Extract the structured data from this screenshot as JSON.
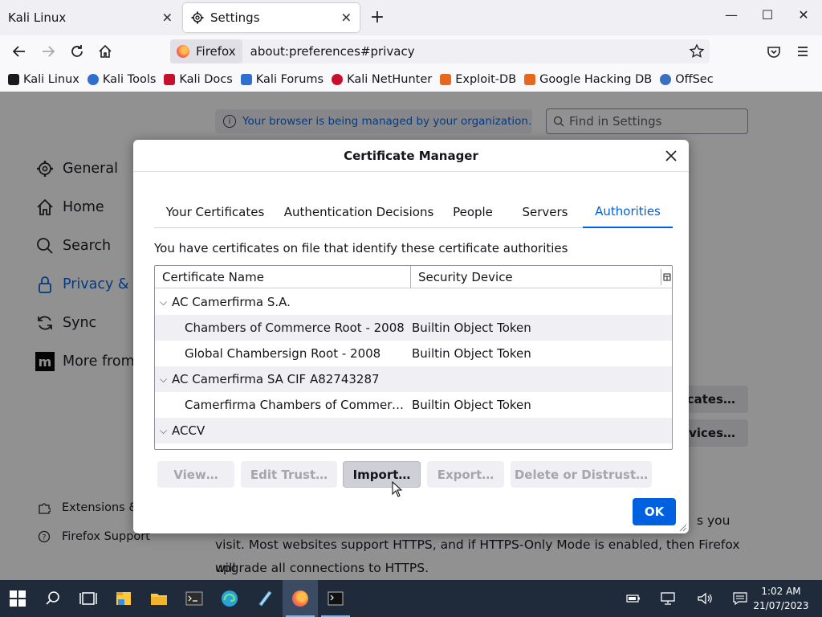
{
  "browser": {
    "tabs": [
      {
        "label": "Kali Linux",
        "active": false
      },
      {
        "label": "Settings",
        "active": true
      }
    ],
    "new_tab": "+",
    "window_controls": {
      "minimize": "—",
      "maximize": "☐",
      "close": "✕"
    },
    "identity_label": "Firefox",
    "url": "about:preferences#privacy",
    "bookmarks": [
      {
        "label": "Kali Linux",
        "color": "#1a1a1a"
      },
      {
        "label": "Kali Tools",
        "color": "#2f6fd0"
      },
      {
        "label": "Kali Docs",
        "color": "#c8102e"
      },
      {
        "label": "Kali Forums",
        "color": "#2f6fd0"
      },
      {
        "label": "Kali NetHunter",
        "color": "#c8102e"
      },
      {
        "label": "Exploit-DB",
        "color": "#e7671c"
      },
      {
        "label": "Google Hacking DB",
        "color": "#e7671c"
      },
      {
        "label": "OffSec",
        "color": "#3b6fc2"
      }
    ]
  },
  "page": {
    "managed_notice": "Your browser is being managed by your organization.",
    "search_placeholder": "Find in Settings",
    "sidebar": [
      {
        "label": "General",
        "icon": "gear-icon"
      },
      {
        "label": "Home",
        "icon": "home-icon"
      },
      {
        "label": "Search",
        "icon": "search-icon"
      },
      {
        "label": "Privacy & S",
        "icon": "lock-icon",
        "active": true
      },
      {
        "label": "Sync",
        "icon": "sync-icon"
      },
      {
        "label": "More from M",
        "icon": "mozilla-icon"
      }
    ],
    "sidebar_footer": [
      {
        "label": "Extensions &",
        "icon": "puzzle-icon"
      },
      {
        "label": "Firefox Support",
        "icon": "help-icon"
      }
    ],
    "right_buttons": [
      "cates…",
      "vices…"
    ],
    "body_lines": [
      "s you",
      "visit. Most websites support HTTPS, and if HTTPS-Only Mode is enabled, then Firefox will",
      "upgrade all connections to HTTPS."
    ]
  },
  "dialog": {
    "title": "Certificate Manager",
    "tabs": [
      "Your Certificates",
      "Authentication Decisions",
      "People",
      "Servers",
      "Authorities"
    ],
    "selected_tab": "Authorities",
    "description": "You have certificates on file that identify these certificate authorities",
    "columns": [
      "Certificate Name",
      "Security Device"
    ],
    "rows": [
      {
        "name": "AC Camerfirma S.A.",
        "device": "",
        "group": true
      },
      {
        "name": "Chambers of Commerce Root - 2008",
        "device": "Builtin Object Token",
        "group": false
      },
      {
        "name": "Global Chambersign Root - 2008",
        "device": "Builtin Object Token",
        "group": false
      },
      {
        "name": "AC Camerfirma SA CIF A82743287",
        "device": "",
        "group": true
      },
      {
        "name": "Camerfirma Chambers of Commerce …",
        "device": "Builtin Object Token",
        "group": false
      },
      {
        "name": "ACCV",
        "device": "",
        "group": true
      }
    ],
    "buttons": [
      {
        "label": "View…",
        "enabled": false
      },
      {
        "label": "Edit Trust…",
        "enabled": false
      },
      {
        "label": "Import…",
        "enabled": true
      },
      {
        "label": "Export…",
        "enabled": false
      },
      {
        "label": "Delete or Distrust…",
        "enabled": false
      }
    ],
    "ok_label": "OK"
  },
  "taskbar": {
    "time": "1:02 AM",
    "date": "21/07/2023"
  },
  "colors": {
    "accent": "#0061e0",
    "taskbar": "#1f2b3a"
  }
}
